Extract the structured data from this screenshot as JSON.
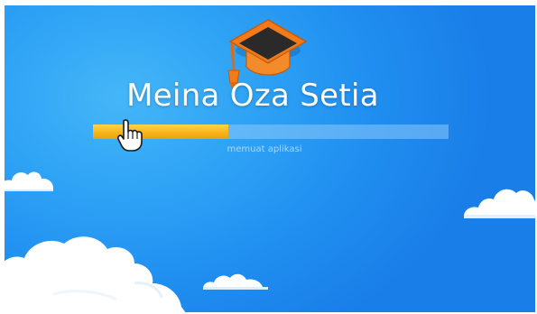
{
  "app": {
    "title": "Meina Oza Setia",
    "logo_icon": "graduation-cap-icon"
  },
  "loader": {
    "progress": 0.38,
    "status_text": "memuat aplikasi",
    "cursor_icon": "hand-pointer-icon"
  },
  "colors": {
    "background_light": "#45b6f7",
    "background_dark": "#1a7ee8",
    "progress_fill": "#f6b51a",
    "logo_orange": "#f27a1a"
  }
}
